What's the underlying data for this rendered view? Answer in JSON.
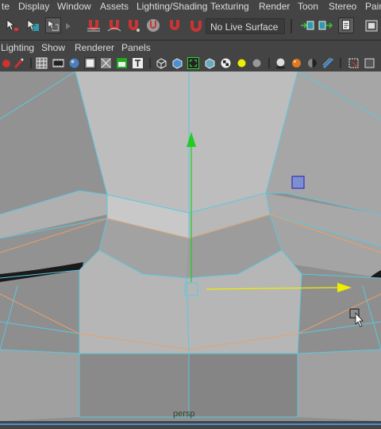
{
  "menu": {
    "items": [
      {
        "label": "te"
      },
      {
        "label": "Display"
      },
      {
        "label": "Window"
      },
      {
        "label": "Assets"
      },
      {
        "label": "Lighting/Shading"
      },
      {
        "label": "Texturing"
      },
      {
        "label": "Render"
      },
      {
        "label": "Toon"
      },
      {
        "label": "Stereo"
      },
      {
        "label": "Pain"
      }
    ]
  },
  "status_line": {
    "live_surface": "No Live Surface"
  },
  "panel_menu": {
    "items": [
      {
        "label": "Lighting"
      },
      {
        "label": "Show"
      },
      {
        "label": "Renderer"
      },
      {
        "label": "Panels"
      }
    ]
  },
  "viewport": {
    "camera": "persp"
  },
  "colors": {
    "wireframe": "#5bc8e0",
    "manip_y": "#22cc22",
    "manip_x": "#eeee00",
    "edge_highlight": "#e8a06a",
    "selected_face": "#3030c0"
  }
}
